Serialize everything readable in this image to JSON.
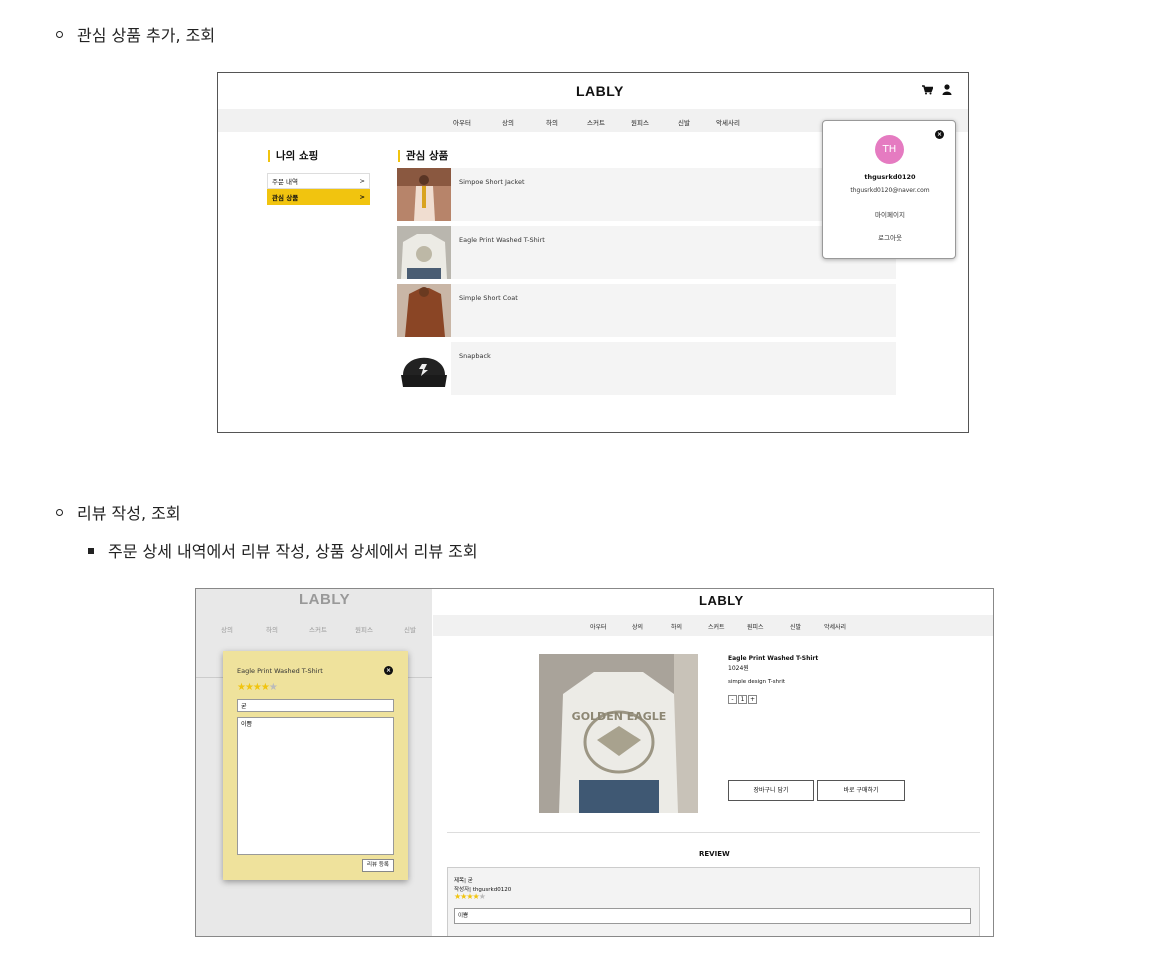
{
  "doc": {
    "bullet1": "관심 상품 추가, 조회",
    "bullet2": "리뷰 작성, 조회",
    "bullet2_sub": "주문 상세 내역에서 리뷰 작성, 상품 상세에서 리뷰 조회"
  },
  "shot1": {
    "logo": "LABLY",
    "nav": [
      "아우터",
      "상의",
      "하의",
      "스커트",
      "원피스",
      "신발",
      "악세사리"
    ],
    "my_shopping_title": "나의 쇼핑",
    "wishlist_title": "관심 상품",
    "menu": [
      {
        "label": "주문 내역",
        "arrow": ">"
      },
      {
        "label": "관심 상품",
        "arrow": ">"
      }
    ],
    "wishlist": [
      "Simpoe Short Jacket",
      "Eagle Print Washed T-Shirt",
      "Simple Short Coat",
      "Snapback"
    ],
    "popup": {
      "avatar": "TH",
      "username": "thgusrkd0120",
      "email": "thgusrkd0120@naver.com",
      "mypage": "마이페이지",
      "logout": "로그아웃"
    }
  },
  "shot2": {
    "logo_left": "LABLY",
    "nav_left": [
      "상의",
      "하의",
      "스커트",
      "원피스",
      "신발"
    ],
    "logo": "LABLY",
    "nav": [
      "아우터",
      "상의",
      "하의",
      "스커트",
      "원피스",
      "신발",
      "악세사리"
    ],
    "modal": {
      "product": "Eagle Print Washed T-Shirt",
      "rating": 4,
      "title_value": "굳",
      "body_value": "이쁨",
      "submit": "리뷰 등록"
    },
    "product": {
      "name": "Eagle Print Washed T-Shirt",
      "price": "1024원",
      "description": "simple design T-shrit",
      "qty_minus": "-",
      "qty": "1",
      "qty_plus": "+",
      "cart_button": "장바구니 담기",
      "buy_button": "바로 구매하기",
      "print_text": "GOLDEN EAGLE"
    },
    "review_heading": "REVIEW",
    "review": {
      "title": "제목| 굳",
      "author": "작성자| thgusrkd0120",
      "rating": 4,
      "body": "이쁨"
    }
  }
}
